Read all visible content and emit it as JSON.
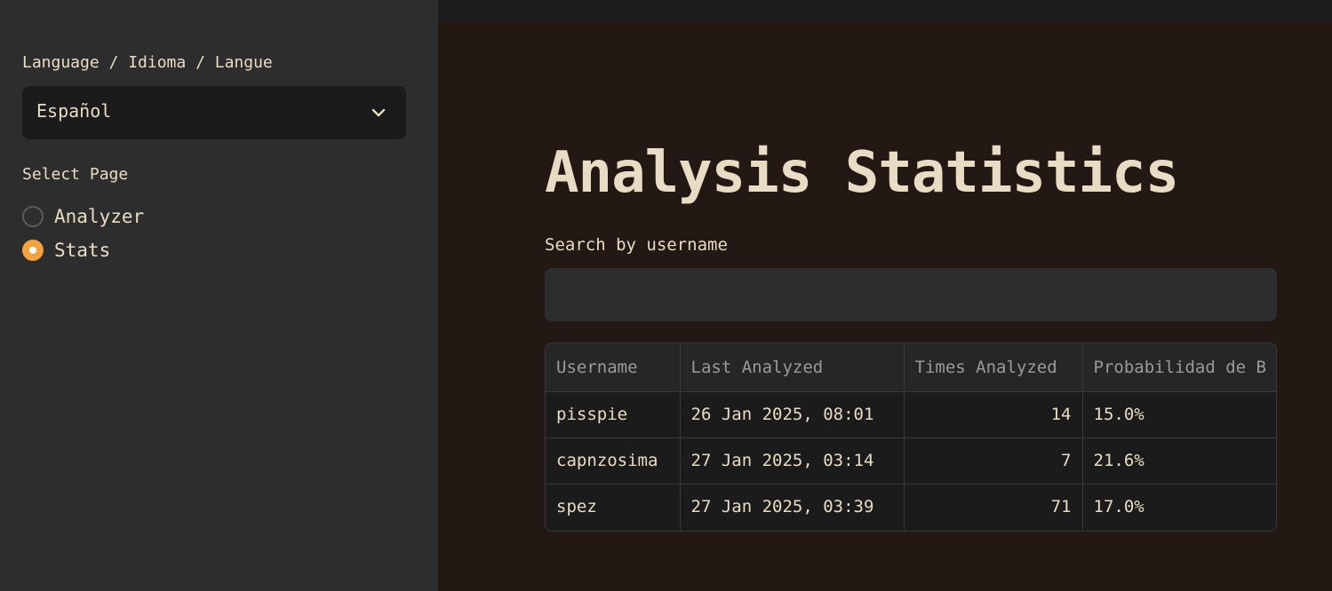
{
  "sidebar": {
    "language_label": "Language / Idioma / Langue",
    "language_value": "Español",
    "page_label": "Select Page",
    "pages": [
      {
        "label": "Analyzer",
        "selected": false
      },
      {
        "label": "Stats",
        "selected": true
      }
    ]
  },
  "main": {
    "title": "Analysis Statistics",
    "search_label": "Search by username",
    "search_value": "",
    "table": {
      "headers": [
        "Username",
        "Last Analyzed",
        "Times Analyzed",
        "Probabilidad de B"
      ],
      "rows": [
        [
          "pisspie",
          "26 Jan 2025, 08:01",
          "14",
          "15.0%"
        ],
        [
          "capnzosima",
          "27 Jan 2025, 03:14",
          "7",
          "21.6%"
        ],
        [
          "spez",
          "27 Jan 2025, 03:39",
          "71",
          "17.0%"
        ]
      ]
    }
  },
  "colors": {
    "accent": "#f4a13f",
    "text": "#e8dcc4",
    "sidebar_bg": "#2d2d2d",
    "main_bg": "#231813"
  }
}
